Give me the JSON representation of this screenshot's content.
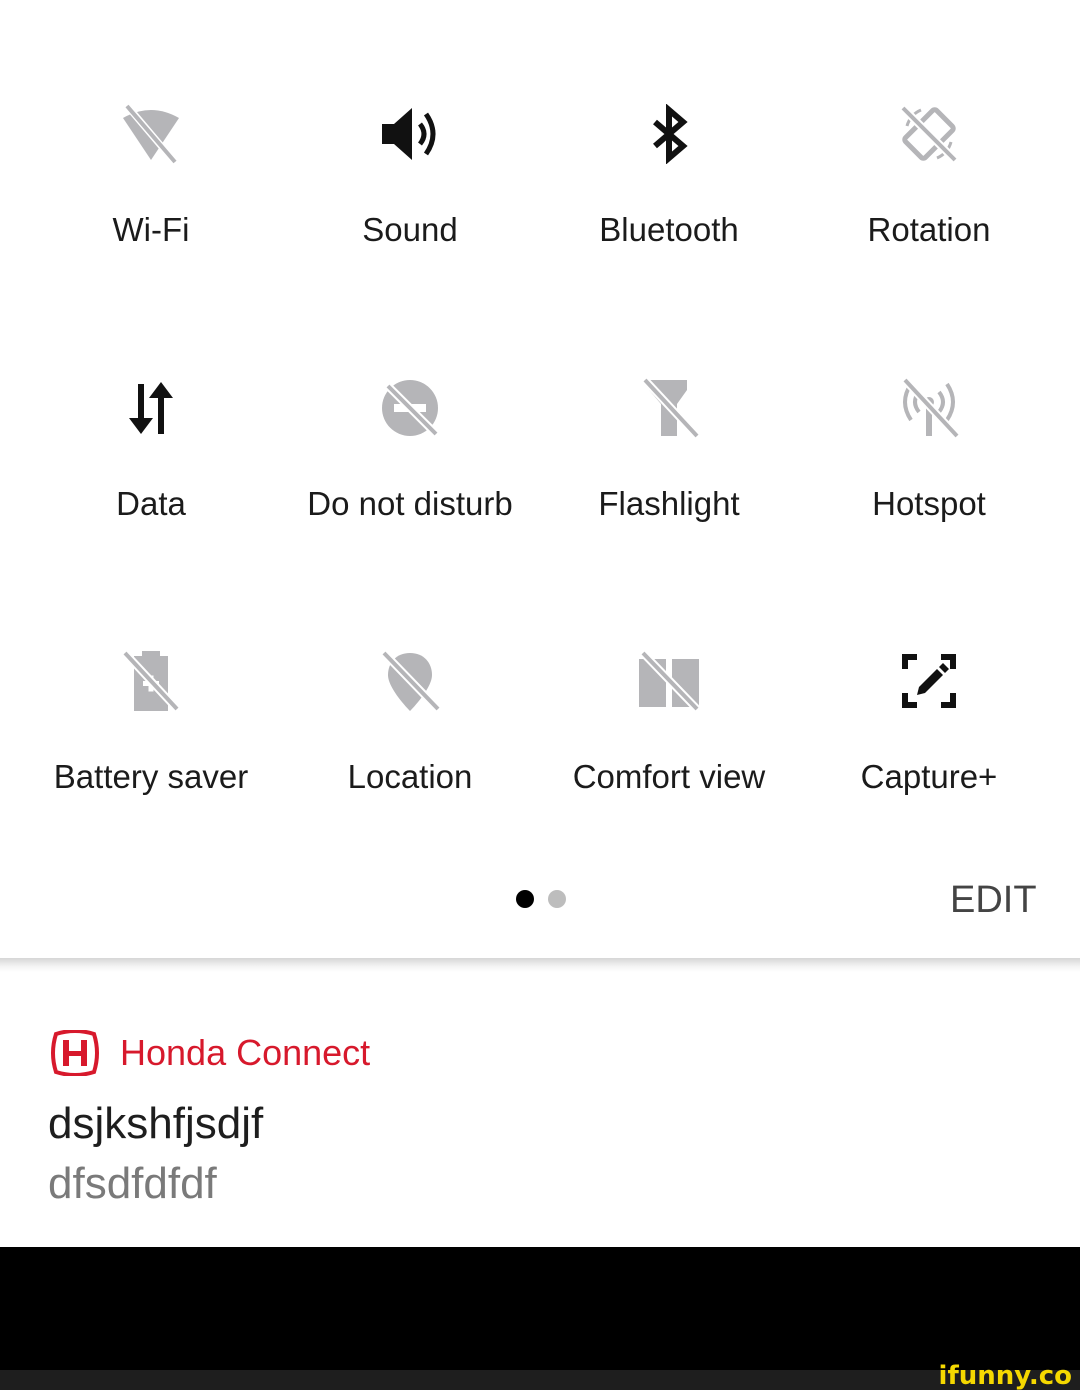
{
  "quick_settings": {
    "tiles": [
      {
        "label": "Wi-Fi",
        "icon": "wifi-off-icon",
        "active": false
      },
      {
        "label": "Sound",
        "icon": "volume-icon",
        "active": true
      },
      {
        "label": "Bluetooth",
        "icon": "bluetooth-icon",
        "active": true
      },
      {
        "label": "Rotation",
        "icon": "rotation-lock-icon",
        "active": false
      },
      {
        "label": "Data",
        "icon": "data-arrows-icon",
        "active": true
      },
      {
        "label": "Do not disturb",
        "icon": "do-not-disturb-icon",
        "active": false
      },
      {
        "label": "Flashlight",
        "icon": "flashlight-off-icon",
        "active": false
      },
      {
        "label": "Hotspot",
        "icon": "hotspot-off-icon",
        "active": false
      },
      {
        "label": "Battery saver",
        "icon": "battery-saver-off-icon",
        "active": false
      },
      {
        "label": "Location",
        "icon": "location-off-icon",
        "active": false
      },
      {
        "label": "Comfort view",
        "icon": "comfort-view-off-icon",
        "active": false
      },
      {
        "label": "Capture+",
        "icon": "capture-plus-icon",
        "active": true
      }
    ],
    "page_indicator": {
      "current_page": 1,
      "page_count": 2
    },
    "edit_label": "EDIT"
  },
  "notification": {
    "app_name": "Honda Connect",
    "app_icon": "honda-logo-icon",
    "title": "dsjkshfjsdjf",
    "text": "dfsdfdfdf"
  },
  "watermark": "ifunny.co",
  "colors": {
    "active_icon": "#111111",
    "inactive_icon": "#b5b5b8",
    "label_text": "#1b1b1b",
    "honda_red": "#d7192c",
    "secondary_text": "#7a7a7a",
    "dot_active": "#000000",
    "dot_inactive": "#bdbdbd",
    "watermark": "#f5d800"
  }
}
